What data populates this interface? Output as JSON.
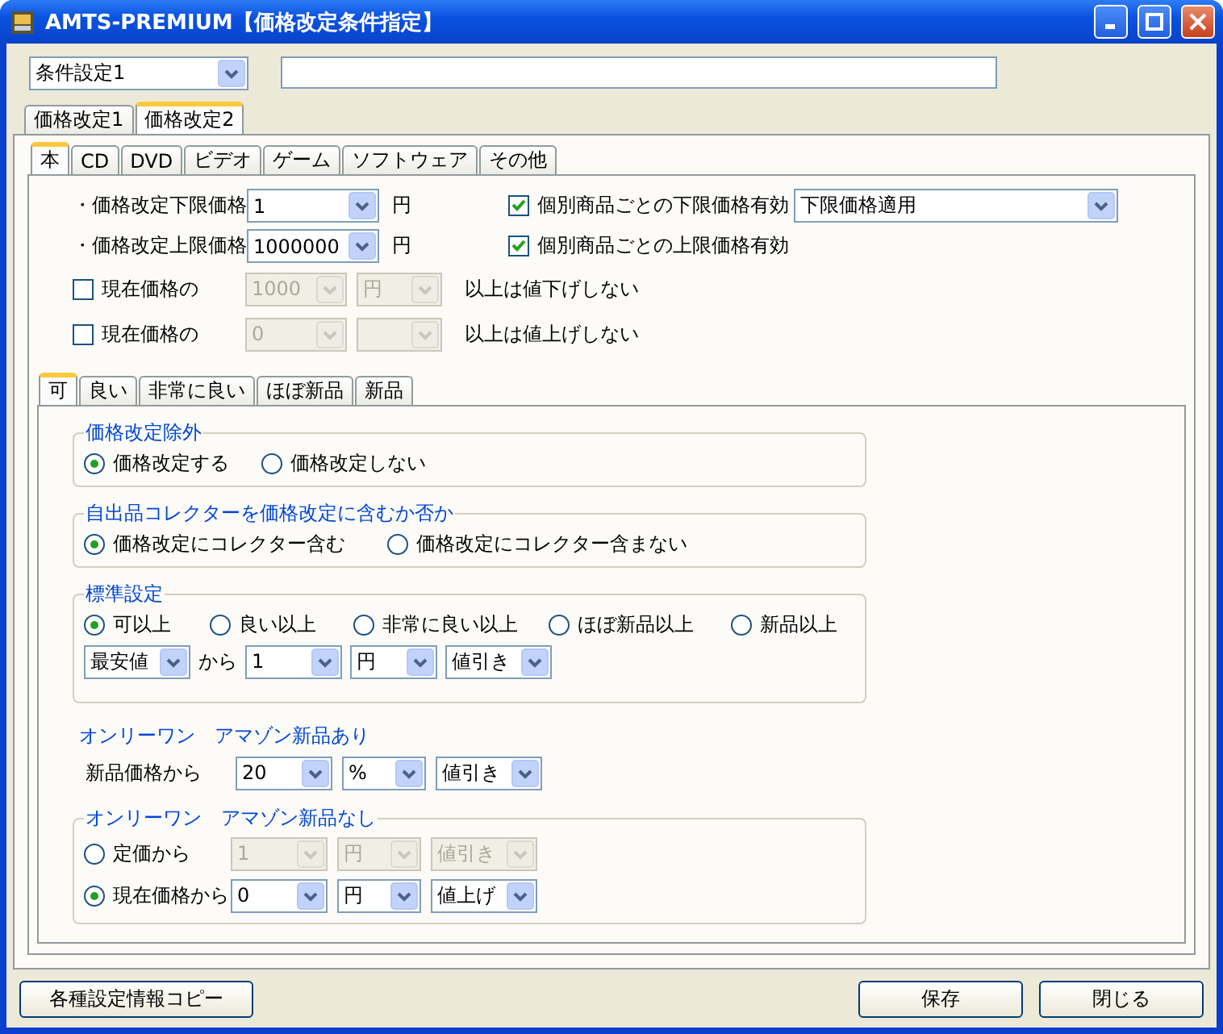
{
  "window": {
    "title": "AMTS-PREMIUM【価格改定条件指定】"
  },
  "condition_select": {
    "value": "条件設定1"
  },
  "main_tabs": [
    {
      "label": "価格改定1",
      "selected": false
    },
    {
      "label": "価格改定2",
      "selected": true
    }
  ],
  "category_tabs": [
    {
      "label": "本",
      "selected": true
    },
    {
      "label": "CD",
      "selected": false
    },
    {
      "label": "DVD",
      "selected": false
    },
    {
      "label": "ビデオ",
      "selected": false
    },
    {
      "label": "ゲーム",
      "selected": false
    },
    {
      "label": "ソフトウェア",
      "selected": false
    },
    {
      "label": "その他",
      "selected": false
    }
  ],
  "limits": [
    {
      "label": "・価格改定下限価格",
      "value": "1",
      "unit": "円",
      "check_label": "個別商品ごとの下限価格有効",
      "checked": true,
      "dropdown": "下限価格適用"
    },
    {
      "label": "・価格改定上限価格",
      "value": "1000000",
      "unit": "円",
      "check_label": "個別商品ごとの上限価格有効",
      "checked": true
    }
  ],
  "no_change_rows": [
    {
      "label": "現在価格の",
      "checked": false,
      "value": "1000",
      "unit": "円",
      "suffix": "以上は値下げしない"
    },
    {
      "label": "現在価格の",
      "checked": false,
      "value": "0",
      "suffix": "以上は値上げしない"
    }
  ],
  "condition_tabs": [
    {
      "label": "可",
      "selected": true
    },
    {
      "label": "良い",
      "selected": false
    },
    {
      "label": "非常に良い",
      "selected": false
    },
    {
      "label": "ほぼ新品",
      "selected": false
    },
    {
      "label": "新品",
      "selected": false
    }
  ],
  "exclusion": {
    "title": "価格改定除外",
    "options": [
      {
        "label": "価格改定する",
        "selected": true
      },
      {
        "label": "価格改定しない",
        "selected": false
      }
    ]
  },
  "collector": {
    "title": "自出品コレクターを価格改定に含むか否か",
    "options": [
      {
        "label": "価格改定にコレクター含む",
        "selected": true
      },
      {
        "label": "価格改定にコレクター含まない",
        "selected": false
      }
    ]
  },
  "standard": {
    "title": "標準設定",
    "options": [
      {
        "label": "可以上",
        "selected": true
      },
      {
        "label": "良い以上",
        "selected": false
      },
      {
        "label": "非常に良い以上",
        "selected": false
      },
      {
        "label": "ほぼ新品以上",
        "selected": false
      },
      {
        "label": "新品以上",
        "selected": false
      }
    ],
    "row": [
      {
        "kind": "select",
        "value": "最安値"
      },
      {
        "kind": "text",
        "value": "から"
      },
      {
        "kind": "select",
        "value": "1"
      },
      {
        "kind": "select",
        "value": "円"
      },
      {
        "kind": "select",
        "value": "値引き"
      }
    ]
  },
  "only_one_new": {
    "title": "オンリーワン　アマゾン新品あり",
    "label": "新品価格から",
    "selects": [
      "20",
      "%",
      "値引き"
    ]
  },
  "only_one_none": {
    "title": "オンリーワン　アマゾン新品なし",
    "options": [
      {
        "label": "定価から",
        "selected": false,
        "disabled": true,
        "selects": [
          "1",
          "円",
          "値引き"
        ]
      },
      {
        "label": "現在価格から",
        "selected": true,
        "disabled": false,
        "selects": [
          "0",
          "円",
          "値上げ"
        ]
      }
    ]
  },
  "buttons": {
    "copy": "各種設定情報コピー",
    "save": "保存",
    "close": "閉じる"
  }
}
